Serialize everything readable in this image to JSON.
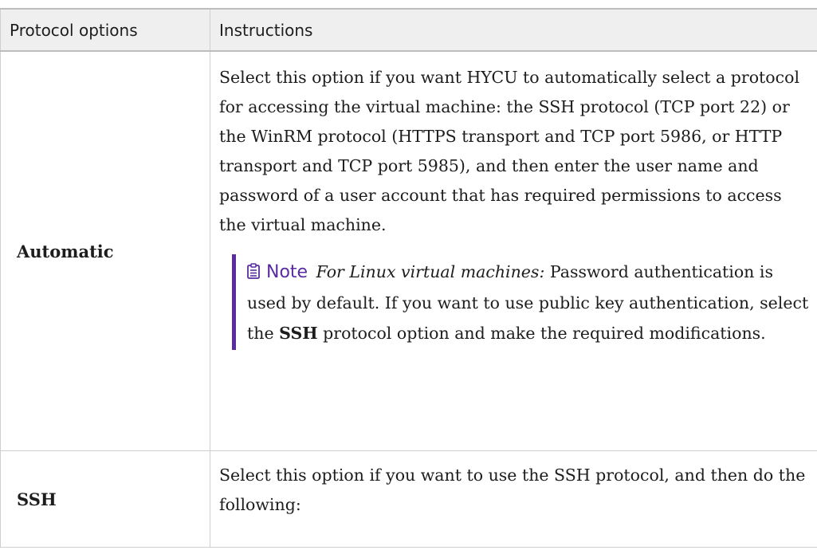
{
  "table": {
    "headers": [
      "Protocol options",
      "Instructions"
    ],
    "rows": [
      {
        "option": "Automatic",
        "instruction": "Select this option if you want HYCU to automatically select a protocol for accessing the virtual machine: the SSH protocol (TCP port 22) or the WinRM protocol (HTTPS transport and TCP port 5986, or HTTP transport and TCP port 5985), and then enter the user name and password of a user account that has required permissions to access the virtual machine.",
        "note": {
          "title": "Note",
          "icon": "clipboard-note-icon",
          "intro": "For Linux virtual machines:",
          "text_before": " Password authentication is used by default. If you want to use public key authentication, select the ",
          "bold": "SSH",
          "text_after": " protocol option and make the required modifications."
        }
      },
      {
        "option": "SSH",
        "instruction": "Select this option if you want to use the SSH protocol, and then do the following:"
      }
    ]
  },
  "colors": {
    "accent": "#5a2ca0",
    "header_bg": "#efefef",
    "border": "#cfcfcf"
  }
}
